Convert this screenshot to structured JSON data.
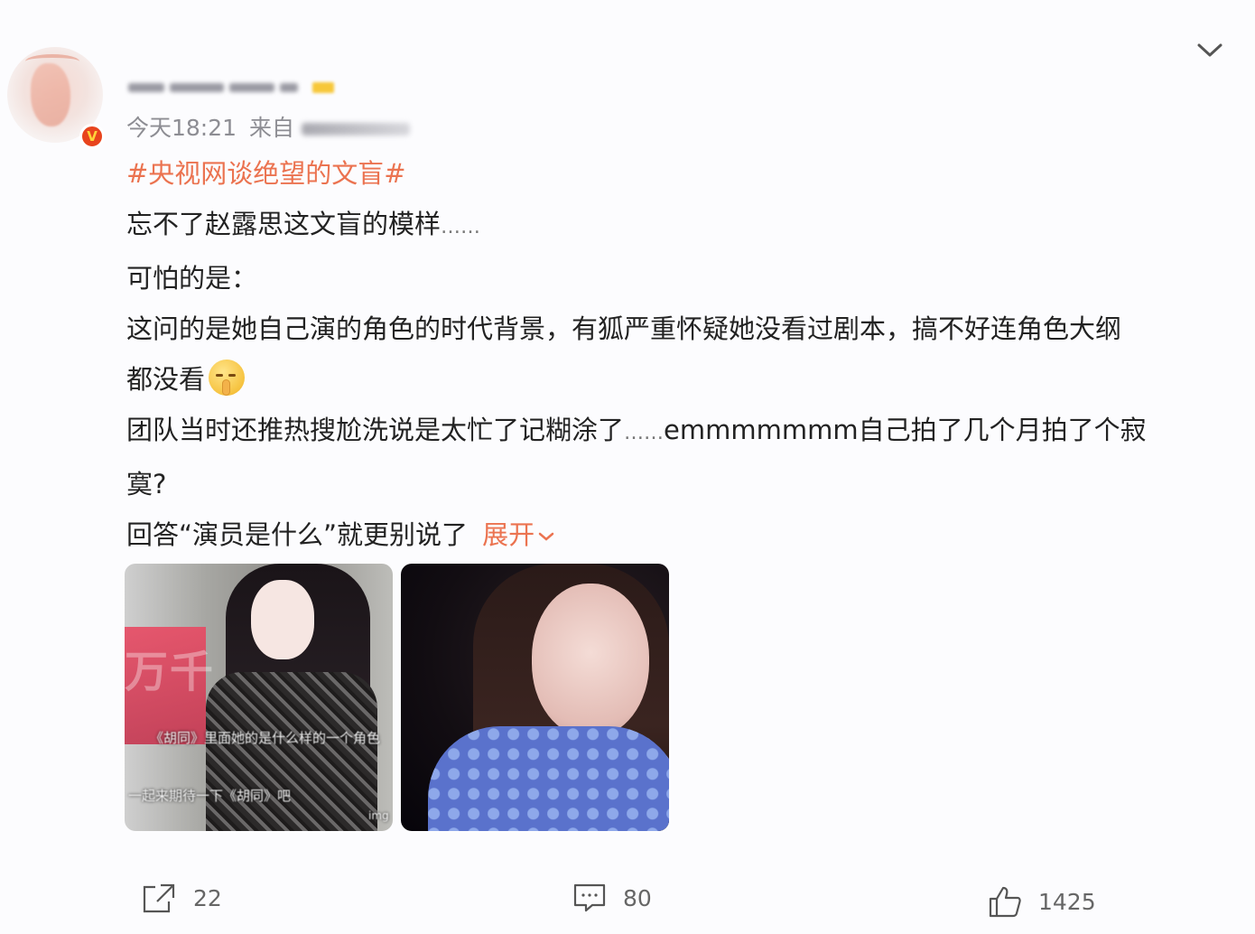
{
  "post": {
    "time": "今天18:21",
    "source_prefix": "来自",
    "hashtag": "#央视网谈绝望的文盲#",
    "lines": [
      "忘不了赵露思这文盲的模样",
      "可怕的是：",
      "这问的是她自己演的角色的时代背景，有狐严重怀疑她没看过剧本，搞不好连角色大纲",
      "都没看",
      "团队当时还推热搜尬洗说是太忙了记糊涂了",
      "emmmmmmm自己拍了几个月拍了个寂",
      "寞?",
      "回答“演员是什么”就更别说了"
    ],
    "ellipsis": "……",
    "expand_label": "展开",
    "images": [
      {
        "sign_text": "万千",
        "subtitle_1": "《胡同》里面她的是什么样的一个角色",
        "subtitle_2": "一起来期待一下《胡同》吧",
        "watermark": "img"
      },
      {}
    ]
  },
  "icons": {
    "verified": "verified-v-badge",
    "chevron": "chevron-down-icon",
    "emoji": "shush-emoji"
  },
  "actions": {
    "share_count": "22",
    "comment_count": "80",
    "like_count": "1425"
  },
  "colors": {
    "accent": "#eb7350",
    "verified": "#e8441d"
  }
}
